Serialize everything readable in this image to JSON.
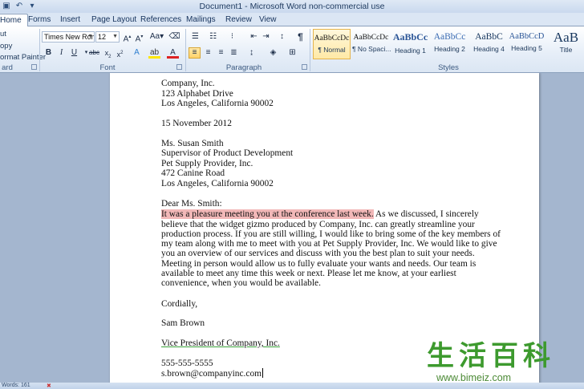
{
  "window": {
    "title": "Document1 - Microsoft Word non-commercial use"
  },
  "quick_access": {
    "save_icon": "save-icon",
    "undo_icon": "undo-icon",
    "more_icon": "chevron-down-icon"
  },
  "tabs": [
    "Home",
    "Forms",
    "Insert",
    "Page Layout",
    "References",
    "Mailings",
    "Review",
    "View"
  ],
  "ribbon": {
    "clipboard": {
      "cut": "ut",
      "copy": "opy",
      "format_painter": "ormat Painter",
      "label": "ard"
    },
    "font": {
      "name": "Times New Rom",
      "size": "12",
      "label": "Font"
    },
    "paragraph": {
      "label": "Paragraph"
    },
    "styles": {
      "label": "Styles",
      "items": [
        {
          "sample": "AaBbCcDc",
          "name": "¶ Normal"
        },
        {
          "sample": "AaBbCcDc",
          "name": "¶ No Spaci..."
        },
        {
          "sample": "AaBbCc",
          "name": "Heading 1"
        },
        {
          "sample": "AaBbCc",
          "name": "Heading 2"
        },
        {
          "sample": "AaBbC",
          "name": "Heading 4"
        },
        {
          "sample": "AaBbCcD",
          "name": "Heading 5"
        },
        {
          "sample": "AaB",
          "name": "Title"
        }
      ]
    }
  },
  "document": {
    "lines": [
      "Company, Inc.",
      "123 Alphabet Drive",
      "Los Angeles, California 90002",
      "",
      "15 November 2012",
      "",
      "Ms. Susan Smith",
      "Supervisor of Product Development",
      "Pet Supply Provider, Inc.",
      "472 Canine Road",
      "Los Angeles, California 90002",
      "",
      "Dear Ms. Smith:"
    ],
    "highlighted": "It was a pleasure meeting you at the conference last week.",
    "after_highlight": " As we discussed, I sincerely",
    "body_lines": [
      "believe that the widget gizmo produced by Company, Inc. can greatly streamline  your",
      "production process. If you are still willing, I would like to bring some of the key members  of",
      "my team along with me to meet with you at Pet Supply Provider, Inc. We would like to give",
      "you an overview of our services  and discuss with you the best plan to suit your needs.",
      "Meeting in person would allow us to fully evaluate your wants and needs. Our team is",
      "available to meet any time this week or next. Please let me know, at your earliest",
      "convenience, when you would be available."
    ],
    "closing": "Cordially,",
    "signature": "Sam Brown",
    "sig_title": "Vice President of Company, Inc.",
    "phone": "555-555-5555",
    "email": "s.brown@companyinc.com"
  },
  "status": {
    "words": "Words: 161"
  },
  "watermark": {
    "chars": [
      "生",
      "活",
      "百",
      "科"
    ],
    "url": "www.bimeiz.com"
  }
}
